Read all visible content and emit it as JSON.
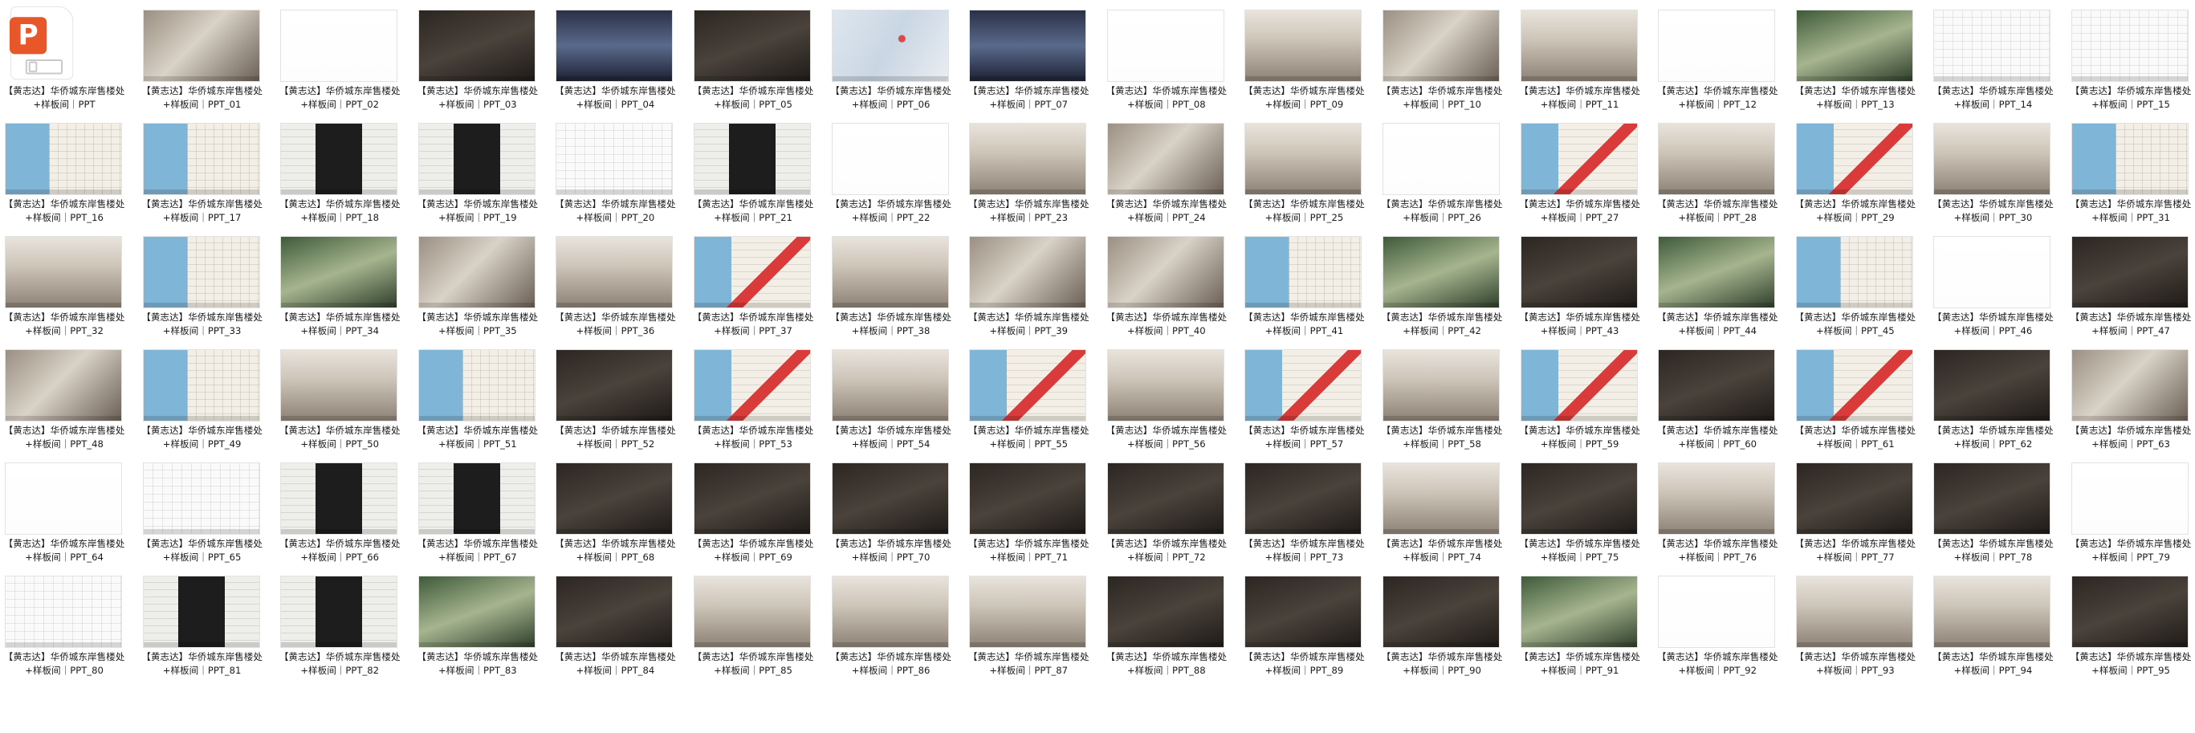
{
  "file_icon": {
    "name": "ppt-file-icon",
    "badge_letter": "P",
    "accent_color": "#e8572a"
  },
  "files": [
    {
      "label": "【黄志达】华侨城东岸售楼处+样板间｜PPT",
      "style": "white"
    },
    {
      "label": "【黄志达】华侨城东岸售楼处+样板间｜PPT_01",
      "style": "photo"
    },
    {
      "label": "【黄志达】华侨城东岸售楼处+样板间｜PPT_02",
      "style": "white"
    },
    {
      "label": "【黄志达】华侨城东岸售楼处+样板间｜PPT_03",
      "style": "dark"
    },
    {
      "label": "【黄志达】华侨城东岸售楼处+样板间｜PPT_04",
      "style": "city"
    },
    {
      "label": "【黄志达】华侨城东岸售楼处+样板间｜PPT_05",
      "style": "dark"
    },
    {
      "label": "【黄志达】华侨城东岸售楼处+样板间｜PPT_06",
      "style": "map"
    },
    {
      "label": "【黄志达】华侨城东岸售楼处+样板间｜PPT_07",
      "style": "city"
    },
    {
      "label": "【黄志达】华侨城东岸售楼处+样板间｜PPT_08",
      "style": "white"
    },
    {
      "label": "【黄志达】华侨城东岸售楼处+样板间｜PPT_09",
      "style": "interior"
    },
    {
      "label": "【黄志达】华侨城东岸售楼处+样板间｜PPT_10",
      "style": "photo"
    },
    {
      "label": "【黄志达】华侨城东岸售楼处+样板间｜PPT_11",
      "style": "interior"
    },
    {
      "label": "【黄志达】华侨城东岸售楼处+样板间｜PPT_12",
      "style": "white"
    },
    {
      "label": "【黄志达】华侨城东岸售楼处+样板间｜PPT_13",
      "style": "green"
    },
    {
      "label": "【黄志达】华侨城东岸售楼处+样板间｜PPT_14",
      "style": "plan"
    },
    {
      "label": "【黄志达】华侨城东岸售楼处+样板间｜PPT_15",
      "style": "plan"
    },
    {
      "label": "【黄志达】华侨城东岸售楼处+样板间｜PPT_16",
      "style": "colorplan"
    },
    {
      "label": "【黄志达】华侨城东岸售楼处+样板间｜PPT_17",
      "style": "colorplan"
    },
    {
      "label": "【黄志达】华侨城东岸售楼处+样板间｜PPT_18",
      "style": "blackplan"
    },
    {
      "label": "【黄志达】华侨城东岸售楼处+样板间｜PPT_19",
      "style": "blackplan"
    },
    {
      "label": "【黄志达】华侨城东岸售楼处+样板间｜PPT_20",
      "style": "plan"
    },
    {
      "label": "【黄志达】华侨城东岸售楼处+样板间｜PPT_21",
      "style": "blackplan"
    },
    {
      "label": "【黄志达】华侨城东岸售楼处+样板间｜PPT_22",
      "style": "white"
    },
    {
      "label": "【黄志达】华侨城东岸售楼处+样板间｜PPT_23",
      "style": "interior"
    },
    {
      "label": "【黄志达】华侨城东岸售楼处+样板间｜PPT_24",
      "style": "photo"
    },
    {
      "label": "【黄志达】华侨城东岸售楼处+样板间｜PPT_25",
      "style": "interior"
    },
    {
      "label": "【黄志达】华侨城东岸售楼处+样板间｜PPT_26",
      "style": "white"
    },
    {
      "label": "【黄志达】华侨城东岸售楼处+样板间｜PPT_27",
      "style": "redplan"
    },
    {
      "label": "【黄志达】华侨城东岸售楼处+样板间｜PPT_28",
      "style": "interior"
    },
    {
      "label": "【黄志达】华侨城东岸售楼处+样板间｜PPT_29",
      "style": "redplan"
    },
    {
      "label": "【黄志达】华侨城东岸售楼处+样板间｜PPT_30",
      "style": "interior"
    },
    {
      "label": "【黄志达】华侨城东岸售楼处+样板间｜PPT_31",
      "style": "colorplan"
    },
    {
      "label": "【黄志达】华侨城东岸售楼处+样板间｜PPT_32",
      "style": "interior"
    },
    {
      "label": "【黄志达】华侨城东岸售楼处+样板间｜PPT_33",
      "style": "colorplan"
    },
    {
      "label": "【黄志达】华侨城东岸售楼处+样板间｜PPT_34",
      "style": "green"
    },
    {
      "label": "【黄志达】华侨城东岸售楼处+样板间｜PPT_35",
      "style": "photo"
    },
    {
      "label": "【黄志达】华侨城东岸售楼处+样板间｜PPT_36",
      "style": "interior"
    },
    {
      "label": "【黄志达】华侨城东岸售楼处+样板间｜PPT_37",
      "style": "redplan"
    },
    {
      "label": "【黄志达】华侨城东岸售楼处+样板间｜PPT_38",
      "style": "interior"
    },
    {
      "label": "【黄志达】华侨城东岸售楼处+样板间｜PPT_39",
      "style": "photo"
    },
    {
      "label": "【黄志达】华侨城东岸售楼处+样板间｜PPT_40",
      "style": "photo"
    },
    {
      "label": "【黄志达】华侨城东岸售楼处+样板间｜PPT_41",
      "style": "colorplan"
    },
    {
      "label": "【黄志达】华侨城东岸售楼处+样板间｜PPT_42",
      "style": "green"
    },
    {
      "label": "【黄志达】华侨城东岸售楼处+样板间｜PPT_43",
      "style": "dark"
    },
    {
      "label": "【黄志达】华侨城东岸售楼处+样板间｜PPT_44",
      "style": "green"
    },
    {
      "label": "【黄志达】华侨城东岸售楼处+样板间｜PPT_45",
      "style": "colorplan"
    },
    {
      "label": "【黄志达】华侨城东岸售楼处+样板间｜PPT_46",
      "style": "white"
    },
    {
      "label": "【黄志达】华侨城东岸售楼处+样板间｜PPT_47",
      "style": "dark"
    },
    {
      "label": "【黄志达】华侨城东岸售楼处+样板间｜PPT_48",
      "style": "photo"
    },
    {
      "label": "【黄志达】华侨城东岸售楼处+样板间｜PPT_49",
      "style": "colorplan"
    },
    {
      "label": "【黄志达】华侨城东岸售楼处+样板间｜PPT_50",
      "style": "interior"
    },
    {
      "label": "【黄志达】华侨城东岸售楼处+样板间｜PPT_51",
      "style": "colorplan"
    },
    {
      "label": "【黄志达】华侨城东岸售楼处+样板间｜PPT_52",
      "style": "dark"
    },
    {
      "label": "【黄志达】华侨城东岸售楼处+样板间｜PPT_53",
      "style": "redplan"
    },
    {
      "label": "【黄志达】华侨城东岸售楼处+样板间｜PPT_54",
      "style": "interior"
    },
    {
      "label": "【黄志达】华侨城东岸售楼处+样板间｜PPT_55",
      "style": "redplan"
    },
    {
      "label": "【黄志达】华侨城东岸售楼处+样板间｜PPT_56",
      "style": "interior"
    },
    {
      "label": "【黄志达】华侨城东岸售楼处+样板间｜PPT_57",
      "style": "redplan"
    },
    {
      "label": "【黄志达】华侨城东岸售楼处+样板间｜PPT_58",
      "style": "interior"
    },
    {
      "label": "【黄志达】华侨城东岸售楼处+样板间｜PPT_59",
      "style": "redplan"
    },
    {
      "label": "【黄志达】华侨城东岸售楼处+样板间｜PPT_60",
      "style": "dark"
    },
    {
      "label": "【黄志达】华侨城东岸售楼处+样板间｜PPT_61",
      "style": "redplan"
    },
    {
      "label": "【黄志达】华侨城东岸售楼处+样板间｜PPT_62",
      "style": "dark"
    },
    {
      "label": "【黄志达】华侨城东岸售楼处+样板间｜PPT_63",
      "style": "photo"
    },
    {
      "label": "【黄志达】华侨城东岸售楼处+样板间｜PPT_64",
      "style": "white"
    },
    {
      "label": "【黄志达】华侨城东岸售楼处+样板间｜PPT_65",
      "style": "plan"
    },
    {
      "label": "【黄志达】华侨城东岸售楼处+样板间｜PPT_66",
      "style": "blackplan"
    },
    {
      "label": "【黄志达】华侨城东岸售楼处+样板间｜PPT_67",
      "style": "blackplan"
    },
    {
      "label": "【黄志达】华侨城东岸售楼处+样板间｜PPT_68",
      "style": "dark"
    },
    {
      "label": "【黄志达】华侨城东岸售楼处+样板间｜PPT_69",
      "style": "dark"
    },
    {
      "label": "【黄志达】华侨城东岸售楼处+样板间｜PPT_70",
      "style": "dark"
    },
    {
      "label": "【黄志达】华侨城东岸售楼处+样板间｜PPT_71",
      "style": "dark"
    },
    {
      "label": "【黄志达】华侨城东岸售楼处+样板间｜PPT_72",
      "style": "dark"
    },
    {
      "label": "【黄志达】华侨城东岸售楼处+样板间｜PPT_73",
      "style": "dark"
    },
    {
      "label": "【黄志达】华侨城东岸售楼处+样板间｜PPT_74",
      "style": "interior"
    },
    {
      "label": "【黄志达】华侨城东岸售楼处+样板间｜PPT_75",
      "style": "dark"
    },
    {
      "label": "【黄志达】华侨城东岸售楼处+样板间｜PPT_76",
      "style": "interior"
    },
    {
      "label": "【黄志达】华侨城东岸售楼处+样板间｜PPT_77",
      "style": "dark"
    },
    {
      "label": "【黄志达】华侨城东岸售楼处+样板间｜PPT_78",
      "style": "dark"
    },
    {
      "label": "【黄志达】华侨城东岸售楼处+样板间｜PPT_79",
      "style": "white"
    },
    {
      "label": "【黄志达】华侨城东岸售楼处+样板间｜PPT_80",
      "style": "plan"
    },
    {
      "label": "【黄志达】华侨城东岸售楼处+样板间｜PPT_81",
      "style": "blackplan"
    },
    {
      "label": "【黄志达】华侨城东岸售楼处+样板间｜PPT_82",
      "style": "blackplan"
    },
    {
      "label": "【黄志达】华侨城东岸售楼处+样板间｜PPT_83",
      "style": "green"
    },
    {
      "label": "【黄志达】华侨城东岸售楼处+样板间｜PPT_84",
      "style": "dark"
    },
    {
      "label": "【黄志达】华侨城东岸售楼处+样板间｜PPT_85",
      "style": "interior"
    },
    {
      "label": "【黄志达】华侨城东岸售楼处+样板间｜PPT_86",
      "style": "interior"
    },
    {
      "label": "【黄志达】华侨城东岸售楼处+样板间｜PPT_87",
      "style": "interior"
    },
    {
      "label": "【黄志达】华侨城东岸售楼处+样板间｜PPT_88",
      "style": "dark"
    },
    {
      "label": "【黄志达】华侨城东岸售楼处+样板间｜PPT_89",
      "style": "dark"
    },
    {
      "label": "【黄志达】华侨城东岸售楼处+样板间｜PPT_90",
      "style": "dark"
    },
    {
      "label": "【黄志达】华侨城东岸售楼处+样板间｜PPT_91",
      "style": "green"
    },
    {
      "label": "【黄志达】华侨城东岸售楼处+样板间｜PPT_92",
      "style": "white"
    },
    {
      "label": "【黄志达】华侨城东岸售楼处+样板间｜PPT_93",
      "style": "interior"
    },
    {
      "label": "【黄志达】华侨城东岸售楼处+样板间｜PPT_94",
      "style": "interior"
    },
    {
      "label": "【黄志达】华侨城东岸售楼处+样板间｜PPT_95",
      "style": "dark"
    }
  ]
}
